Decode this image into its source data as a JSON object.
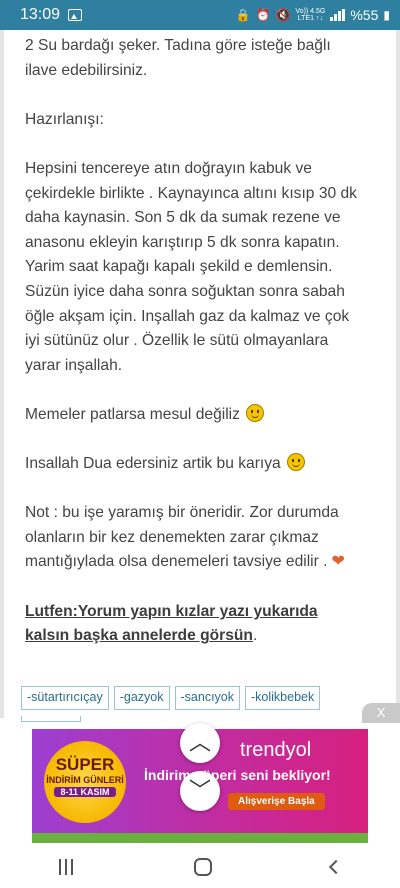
{
  "status_bar": {
    "time": "13:09",
    "network_type_top": "Vo)) 4.5G",
    "network_type_bottom": "LTE1 ↑↓",
    "battery": "%55"
  },
  "article": {
    "p_intro_1": "2 Su bardağı şeker.  Tadına göre isteğe bağlı",
    "p_intro_2": "ilave edebilirsiniz.",
    "heading": "Hazırlanışı:",
    "p_recipe": [
      "Hepsini tencereye atın doğrayın kabuk ve",
      "çekirdekle birlikte . Kaynayınca altını kısıp 30 dk",
      "daha kaynasin. Son 5 dk da sumak rezene ve",
      "anasonu ekleyin karıştırıp 5 dk sonra kapatın.",
      "Yarim saat kapağı kapalı şekild e demlensin.",
      "Süzün iyice daha sonra soğuktan sonra sabah",
      "öğle akşam için.  Inşallah gaz da kalmaz ve çok",
      "iyi sütünüz olur . Özellik le sütü olmayanlara",
      "yarar inşallah."
    ],
    "p_warning": "Memeler patlarsa mesul değiliz",
    "p_dua": "Insallah Dua edersiniz artik bu karıya",
    "p_note_1": "Not : bu işe yaramış bir öneridir.  Zor durumda",
    "p_note_2": "olanların bir kez denemekten zarar çıkmaz",
    "p_note_3": "mantığıylada olsa denemeleri tavsiye edilir .",
    "p_cta_1": "Lutfen:Yorum yapın kızlar yazı yukarıda",
    "p_cta_2": "kalsın başka annelerde görsün",
    "p_cta_tail": "."
  },
  "tags": [
    "-sütartırıcıçay",
    "-gazyok",
    "-sancıyok",
    "-kolikbebek"
  ],
  "ad": {
    "close": "X",
    "badge_l1": "SÜPER",
    "badge_l2": "İNDİRİM GÜNLERİ",
    "badge_l3": "8-11 KASIM",
    "brand": "trendyol",
    "slogan": "İndirim süperi seni bekliyor!",
    "cta": "Alışverişe Başla"
  },
  "icons": {
    "expand_up": "chevron-up-icon",
    "expand_down": "chevron-down-icon"
  }
}
